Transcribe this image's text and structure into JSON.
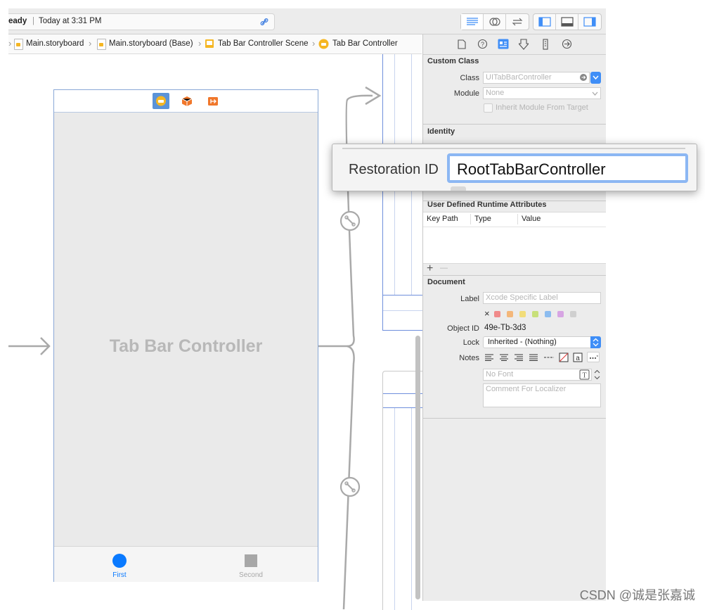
{
  "toolbar": {
    "status_text": "eady",
    "status_time": "Today at 3:31 PM"
  },
  "breadcrumb": {
    "items": [
      "Main.storyboard",
      "Main.storyboard (Base)",
      "Tab Bar Controller Scene",
      "Tab Bar Controller"
    ]
  },
  "canvas": {
    "controller_title": "Tab Bar Controller",
    "tabs": [
      {
        "label": "First",
        "color": "#0a7aff"
      },
      {
        "label": "Second",
        "color": "#a7a7a7"
      }
    ]
  },
  "inspector": {
    "custom_class": {
      "title": "Custom Class",
      "class_label": "Class",
      "class_placeholder": "UITabBarController",
      "module_label": "Module",
      "module_placeholder": "None",
      "inherit_label": "Inherit Module From Target"
    },
    "identity": {
      "title": "Identity"
    },
    "runtime": {
      "title": "User Defined Runtime Attributes",
      "columns": [
        "Key Path",
        "Type",
        "Value"
      ],
      "add": "+",
      "remove": "—"
    },
    "document": {
      "title": "Document",
      "label_label": "Label",
      "label_placeholder": "Xcode Specific Label",
      "clear_mark": "×",
      "swatches": [
        "#f08a8a",
        "#f4b77a",
        "#f2dd7a",
        "#c8e07a",
        "#8cbcef",
        "#d7a5e3",
        "#cfcfcf"
      ],
      "object_id_label": "Object ID",
      "object_id": "49e-Tb-3d3",
      "lock_label": "Lock",
      "lock_value": "Inherited - (Nothing)",
      "notes_label": "Notes",
      "font_placeholder": "No Font",
      "comment_placeholder": "Comment For Localizer"
    }
  },
  "popover": {
    "label": "Restoration ID",
    "value": "RootTabBarController"
  },
  "watermark": "CSDN @诚是张嘉诚",
  "colors": {
    "accent": "#3f8ef7",
    "segue_line": "#a9a9a9",
    "device_border": "#8aa8d6"
  }
}
